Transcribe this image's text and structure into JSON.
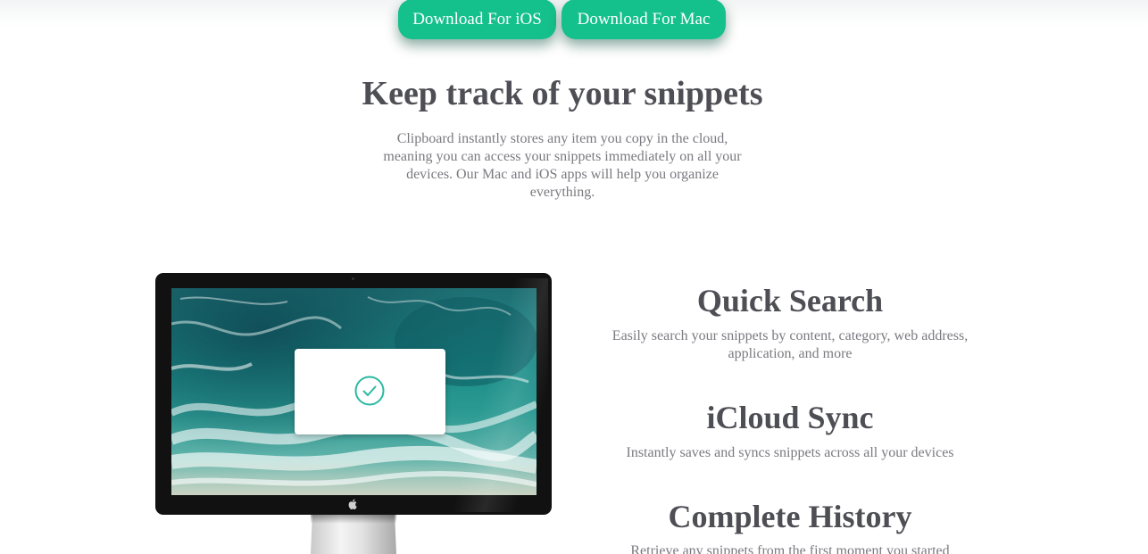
{
  "header": {
    "download_ios_label": "Download For iOS",
    "download_mac_label": "Download For Mac"
  },
  "hero": {
    "title": "Keep track of your snippets",
    "description": "Clipboard instantly stores any item you copy in the cloud, meaning you can access your snippets immediately on all your devices. Our Mac and iOS apps will help you organize everything."
  },
  "monitor": {
    "apple_logo_glyph": ""
  },
  "features": [
    {
      "title": "Quick Search",
      "description": "Easily search your snippets by content, category, web address, application, and more"
    },
    {
      "title": "iCloud Sync",
      "description": "Instantly saves and syncs snippets across all your devices"
    },
    {
      "title": "Complete History",
      "description": "Retrieve any snippets from the first moment you started"
    }
  ],
  "colors": {
    "accent": "#14c08b",
    "heading": "#4e4e55",
    "body_text": "#7a7a80",
    "check": "#2bb9a2"
  },
  "icons": {
    "dialog_icon": "checkmark-circle-icon",
    "monitor_logo": "apple-icon"
  }
}
